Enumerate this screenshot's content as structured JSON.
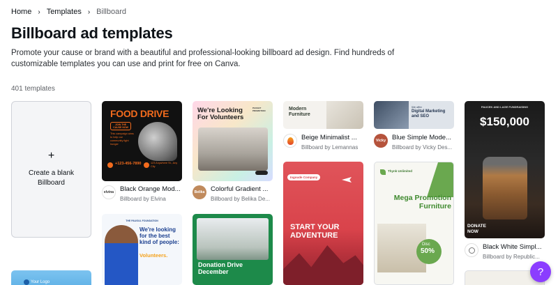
{
  "breadcrumb": {
    "home": "Home",
    "templates": "Templates",
    "current": "Billboard"
  },
  "page": {
    "title": "Billboard ad templates",
    "description": "Promote your cause or brand with a beautiful and professional-looking billboard ad design. Find hundreds of customizable templates you can use and print for free on Canva.",
    "count": "401 templates"
  },
  "blank_card": {
    "plus": "+",
    "label": "Create a blank Billboard"
  },
  "templates": [
    {
      "title": "Black Orange Mod...",
      "by": "Billboard by Elvina",
      "avatar": "elvina",
      "poster": {
        "headline": "FOOD DRIVE",
        "sub": "JOIN THE CAUSE NOW",
        "body": "This campaign aims to help our community fight hunger",
        "phone": "+123-456-7890",
        "address": "123 Anywhere St., Any City"
      }
    },
    {
      "title": "Colorful Gradient ...",
      "by": "Billboard by Belika De...",
      "avatar": "Belika",
      "poster": {
        "headline": "We're Looking For Volunteers",
        "tag": "PAUGET PROMOTION"
      }
    },
    {
      "title": "Beige Minimalist ...",
      "by": "Billboard by Lemannas",
      "poster": {
        "headline": "Modern Furniture"
      }
    },
    {
      "title": "Blue Simple Mode...",
      "by": "Billboard by Vicky Des...",
      "avatar": "Vicky",
      "poster": {
        "tag": "We offer",
        "headline": "Digital Marketing and SEO"
      }
    },
    {
      "title": "Black White Simpl...",
      "by": "Billboard by Republic...",
      "poster": {
        "tag": "PAUCEK AND LAGE FUNDRAISING",
        "headline": "$150,000",
        "cta": "DONATE NOW"
      }
    },
    {
      "poster": {
        "tag": "THE PAUGUL FOUNDATION",
        "headline": "We're looking for the best kind of people:",
        "accent": "Volunteers."
      }
    },
    {
      "poster": {
        "headline": "Donation Drive December"
      }
    },
    {
      "poster": {
        "tag": "Ingoude Company",
        "headline": "START YOUR ADVENTURE"
      }
    },
    {
      "poster": {
        "brand": "Thynk Unlimited",
        "headline": "Mega Promotion Furniture",
        "disc": "Disc",
        "percent": "50%"
      }
    },
    {
      "poster": {
        "tag": "Your Logo"
      }
    }
  ],
  "help": {
    "label": "?"
  },
  "colors": {
    "accent": "#8b3dff",
    "food_drive_orange": "#f26b1d",
    "adventure_red": "#d9434b",
    "donation_green": "#1d8a4a",
    "furniture_green": "#6aa84f"
  }
}
